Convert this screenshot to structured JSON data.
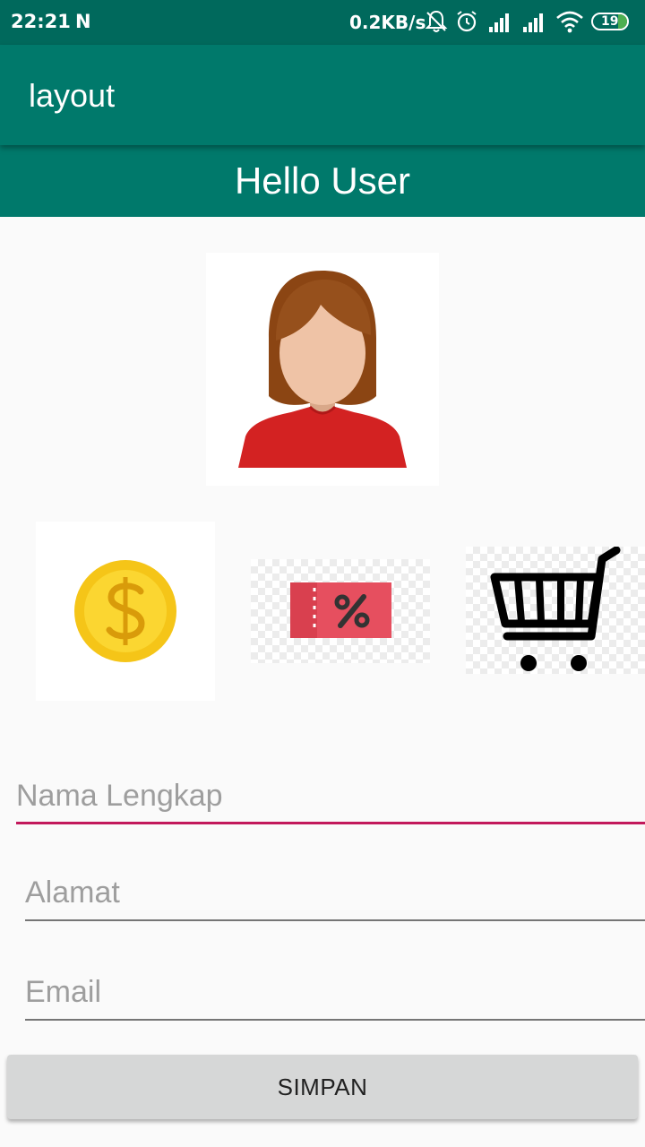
{
  "status_bar": {
    "time": "22:21",
    "network_speed": "0.2KB/s",
    "battery": "19",
    "icons": [
      "notification-n-icon",
      "bell-off-icon",
      "alarm-icon",
      "signal-icon",
      "signal-icon",
      "wifi-icon",
      "battery-icon"
    ]
  },
  "toolbar": {
    "title": "layout"
  },
  "banner": {
    "greeting": "Hello User"
  },
  "images": {
    "avatar": "user-avatar-female",
    "icons": [
      "coin-icon",
      "discount-voucher-icon",
      "shopping-cart-icon"
    ]
  },
  "form": {
    "name_placeholder": "Nama Lengkap",
    "address_placeholder": "Alamat",
    "email_placeholder": "Email"
  },
  "button": {
    "save_label": "SIMPAN"
  },
  "colors": {
    "status_bar": "#00695c",
    "primary": "#00796b",
    "accent": "#c2185b",
    "button": "#d6d7d7"
  }
}
